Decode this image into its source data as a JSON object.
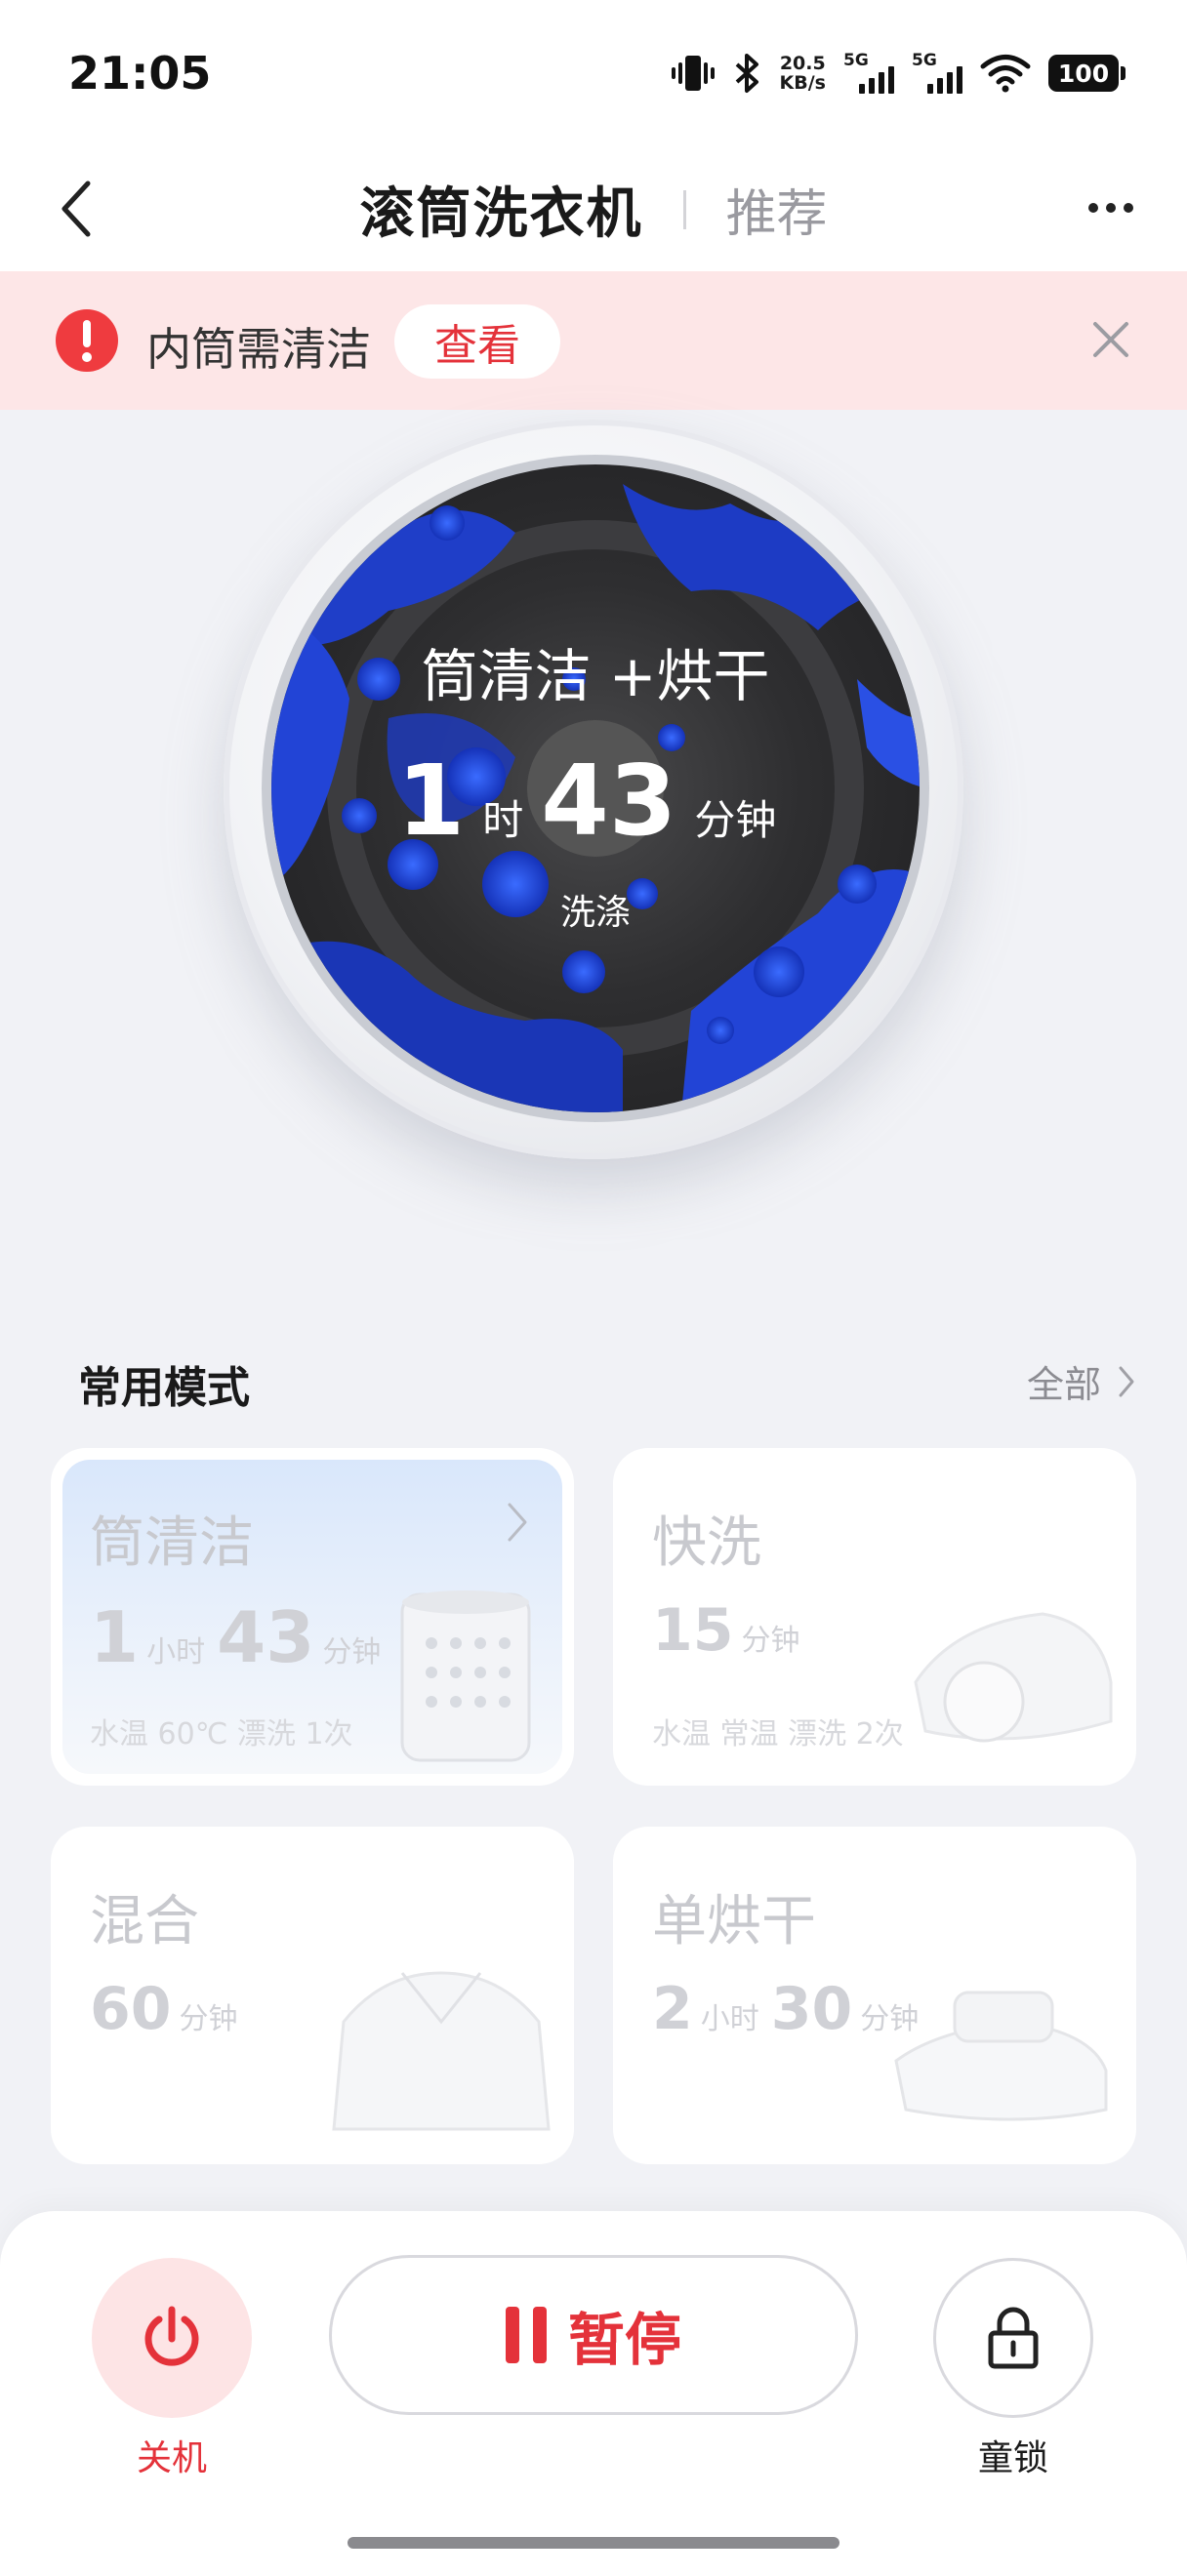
{
  "status_bar": {
    "time": "21:05",
    "net_speed_value": "20.5",
    "net_speed_unit": "KB/s",
    "signal1_label": "5G",
    "signal2_label": "5G",
    "battery": "100",
    "icons": [
      "vibrate-icon",
      "bluetooth-icon",
      "wifi-icon"
    ]
  },
  "header": {
    "title": "滚筒洗衣机",
    "recommend_tab": "推荐"
  },
  "alert": {
    "message": "内筒需清洁",
    "action_label": "查看",
    "icon": "warning-icon",
    "colors": {
      "bg": "#fde6e7",
      "icon": "#ef3b3f",
      "action": "#e4323a"
    }
  },
  "drum": {
    "program": "筒清洁 +烘干",
    "hours": "1",
    "hours_unit": "时",
    "minutes": "43",
    "minutes_unit": "分钟",
    "stage": "洗涤"
  },
  "modes": {
    "section_title": "常用模式",
    "all_label": "全部",
    "cards": [
      {
        "name": "筒清洁",
        "t1": "1",
        "u1": "小时",
        "t2": "43",
        "u2": "分钟",
        "sub": "水温 60℃ 漂洗 1次"
      },
      {
        "name": "快洗",
        "t1": "15",
        "u1": "分钟",
        "sub": "水温 常温 漂洗 2次"
      },
      {
        "name": "混合",
        "t1": "60",
        "u1": "分钟"
      },
      {
        "name": "单烘干",
        "t1": "2",
        "u1": "小时",
        "t2": "30",
        "u2": "分钟"
      }
    ]
  },
  "bottom_bar": {
    "power_label": "关机",
    "pause_label": "暂停",
    "lock_label": "童锁",
    "accent": "#e4323a"
  }
}
